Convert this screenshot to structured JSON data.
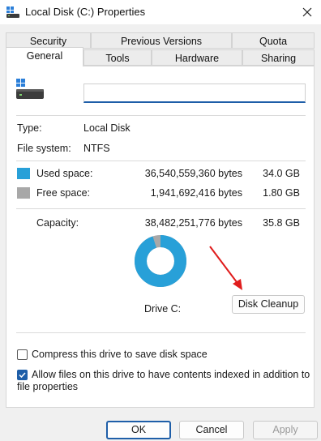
{
  "window": {
    "title": "Local Disk (C:) Properties",
    "close_icon": "close-icon"
  },
  "tabs": {
    "row1": [
      "Security",
      "Previous Versions",
      "Quota"
    ],
    "row2": [
      "General",
      "Tools",
      "Hardware",
      "Sharing"
    ],
    "active": "General"
  },
  "general": {
    "name_value": "",
    "type_label": "Type:",
    "type_value": "Local Disk",
    "fs_label": "File system:",
    "fs_value": "NTFS",
    "used_label": "Used space:",
    "used_bytes": "36,540,559,360 bytes",
    "used_gb": "34.0 GB",
    "free_label": "Free space:",
    "free_bytes": "1,941,692,416 bytes",
    "free_gb": "1.80 GB",
    "capacity_label": "Capacity:",
    "capacity_bytes": "38,482,251,776 bytes",
    "capacity_gb": "35.8 GB",
    "drive_label": "Drive C:",
    "disk_cleanup": "Disk Cleanup",
    "compress_label": "Compress this drive to save disk space",
    "compress_checked": false,
    "index_label_line1": "Allow files on this drive to have contents indexed in addition to",
    "index_label_line2": "file properties",
    "index_checked": true,
    "used_fraction": 0.95
  },
  "colors": {
    "used": "#28a0d8",
    "free": "#a8a8a8",
    "accent": "#1e5ea8",
    "arrow": "#e01c1c"
  },
  "footer": {
    "ok": "OK",
    "cancel": "Cancel",
    "apply": "Apply"
  }
}
